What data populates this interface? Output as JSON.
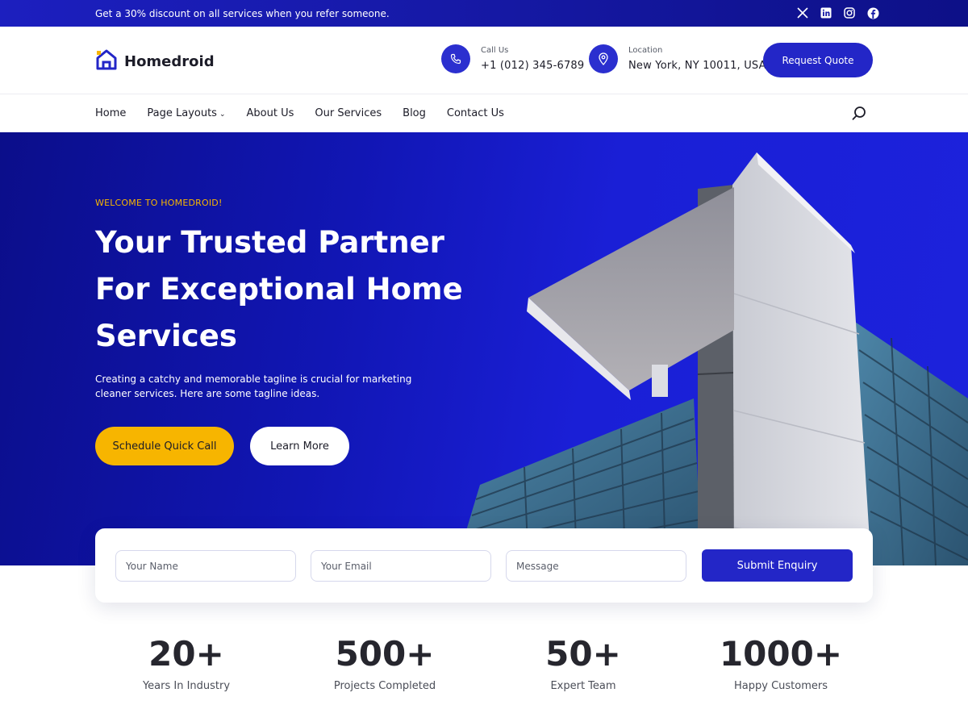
{
  "topbar": {
    "promo": "Get a 30% discount on all services when you refer someone.",
    "socials": [
      "x-icon",
      "linkedin-icon",
      "instagram-icon",
      "facebook-icon"
    ]
  },
  "header": {
    "logo_text": "Homedroid",
    "call_label": "Call Us",
    "call_value": "+1 (012) 345-6789",
    "location_label": "Location",
    "location_value": "New York, NY 10011, USA.",
    "quote_button": "Request Quote"
  },
  "nav": {
    "items": [
      {
        "label": "Home"
      },
      {
        "label": "Page Layouts"
      },
      {
        "label": "About Us"
      },
      {
        "label": "Our Services"
      },
      {
        "label": "Blog"
      },
      {
        "label": "Contact Us"
      }
    ]
  },
  "hero": {
    "eyebrow": "WELCOME TO HOMEDROID!",
    "title": "Your Trusted Partner For Exceptional Home Services",
    "tagline": "Creating a catchy and memorable tagline is crucial for marketing cleaner services. Here are some tagline ideas.",
    "primary_button": "Schedule Quick Call",
    "secondary_button": "Learn More"
  },
  "enquiry": {
    "name_placeholder": "Your Name",
    "email_placeholder": "Your Email",
    "message_placeholder": "Message",
    "submit_label": "Submit Enquiry"
  },
  "stats": [
    {
      "value": "20+",
      "label": "Years In Industry"
    },
    {
      "value": "500+",
      "label": "Projects Completed"
    },
    {
      "value": "50+",
      "label": "Expert Team"
    },
    {
      "value": "1000+",
      "label": "Happy Customers"
    }
  ],
  "colors": {
    "brand_blue": "#2326c7",
    "accent_yellow": "#f7b500",
    "hero_dark": "#0b0e8a"
  }
}
